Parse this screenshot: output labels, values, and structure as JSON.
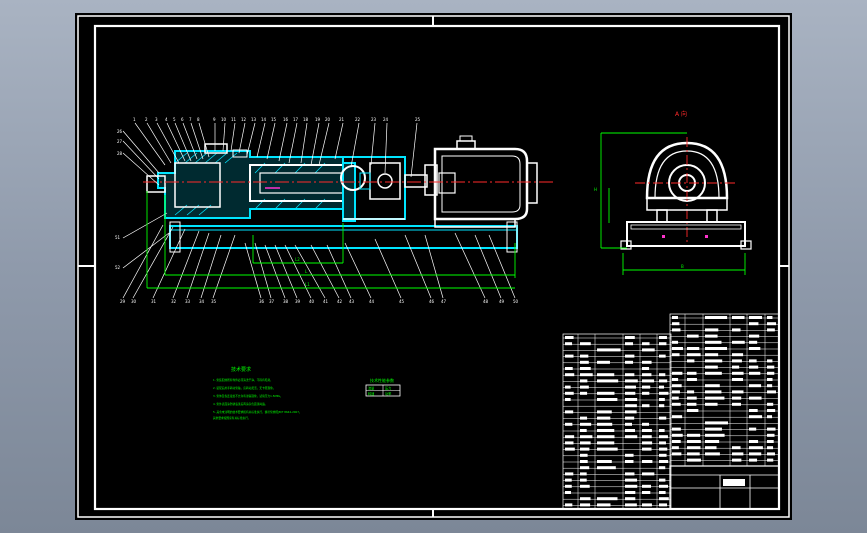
{
  "drawing": {
    "view_label": "A 向",
    "notes": {
      "title": "技术要求",
      "lines": [
        "1. 泵装配前所有零件必须清洗干净，不得有毛刺。",
        "2. 装配后用手转动泵轴，应转动灵活，无卡阻现象。",
        "3. 泵体及各连接处不允许有渗漏现象，试验压力1.5MPa。",
        "4. 泵外表面涂防锈底漆后再涂灰色面漆两遍。",
        "5. 其余未注明的技术要求按有关标准执行，螺杆泵参照JB/T 8644-2007。",
        "其他要求按国家有关标准执行。"
      ]
    },
    "performance_table": {
      "title": "技术性能参数",
      "rows": [
        [
          "流量",
          "压力"
        ],
        [
          "转速",
          "功率"
        ]
      ]
    }
  },
  "colors": {
    "background_top": "#a9b3c2",
    "sheet": "#000000",
    "frame": "#ffffff",
    "section_hatch": "#00e5ff",
    "dimension": "#00ff00",
    "centerline": "#ff2a2a",
    "part_outline": "#ffffff",
    "magenta_mark": "#ff33cc"
  }
}
